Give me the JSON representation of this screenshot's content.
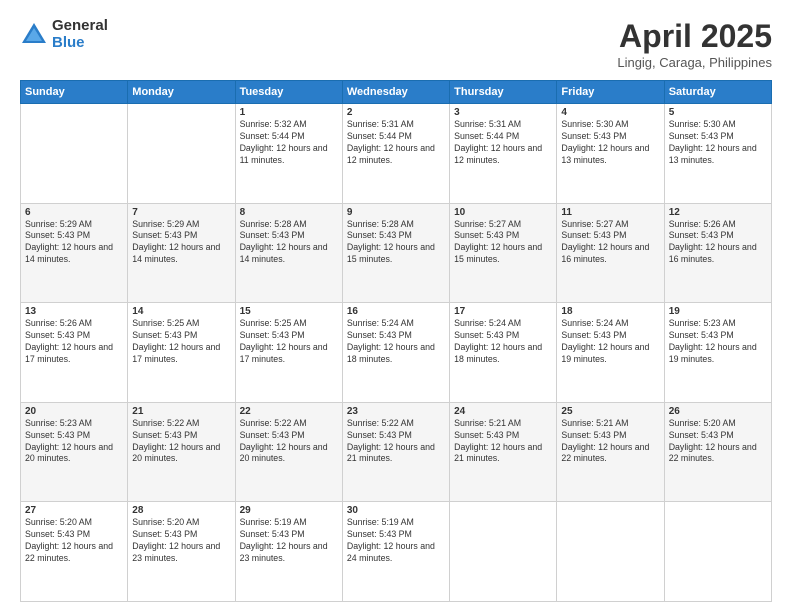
{
  "logo": {
    "general": "General",
    "blue": "Blue"
  },
  "title": "April 2025",
  "subtitle": "Lingig, Caraga, Philippines",
  "days": [
    "Sunday",
    "Monday",
    "Tuesday",
    "Wednesday",
    "Thursday",
    "Friday",
    "Saturday"
  ],
  "weeks": [
    [
      {
        "date": "",
        "info": ""
      },
      {
        "date": "",
        "info": ""
      },
      {
        "date": "1",
        "info": "Sunrise: 5:32 AM\nSunset: 5:44 PM\nDaylight: 12 hours and 11 minutes."
      },
      {
        "date": "2",
        "info": "Sunrise: 5:31 AM\nSunset: 5:44 PM\nDaylight: 12 hours and 12 minutes."
      },
      {
        "date": "3",
        "info": "Sunrise: 5:31 AM\nSunset: 5:44 PM\nDaylight: 12 hours and 12 minutes."
      },
      {
        "date": "4",
        "info": "Sunrise: 5:30 AM\nSunset: 5:43 PM\nDaylight: 12 hours and 13 minutes."
      },
      {
        "date": "5",
        "info": "Sunrise: 5:30 AM\nSunset: 5:43 PM\nDaylight: 12 hours and 13 minutes."
      }
    ],
    [
      {
        "date": "6",
        "info": "Sunrise: 5:29 AM\nSunset: 5:43 PM\nDaylight: 12 hours and 14 minutes."
      },
      {
        "date": "7",
        "info": "Sunrise: 5:29 AM\nSunset: 5:43 PM\nDaylight: 12 hours and 14 minutes."
      },
      {
        "date": "8",
        "info": "Sunrise: 5:28 AM\nSunset: 5:43 PM\nDaylight: 12 hours and 14 minutes."
      },
      {
        "date": "9",
        "info": "Sunrise: 5:28 AM\nSunset: 5:43 PM\nDaylight: 12 hours and 15 minutes."
      },
      {
        "date": "10",
        "info": "Sunrise: 5:27 AM\nSunset: 5:43 PM\nDaylight: 12 hours and 15 minutes."
      },
      {
        "date": "11",
        "info": "Sunrise: 5:27 AM\nSunset: 5:43 PM\nDaylight: 12 hours and 16 minutes."
      },
      {
        "date": "12",
        "info": "Sunrise: 5:26 AM\nSunset: 5:43 PM\nDaylight: 12 hours and 16 minutes."
      }
    ],
    [
      {
        "date": "13",
        "info": "Sunrise: 5:26 AM\nSunset: 5:43 PM\nDaylight: 12 hours and 17 minutes."
      },
      {
        "date": "14",
        "info": "Sunrise: 5:25 AM\nSunset: 5:43 PM\nDaylight: 12 hours and 17 minutes."
      },
      {
        "date": "15",
        "info": "Sunrise: 5:25 AM\nSunset: 5:43 PM\nDaylight: 12 hours and 17 minutes."
      },
      {
        "date": "16",
        "info": "Sunrise: 5:24 AM\nSunset: 5:43 PM\nDaylight: 12 hours and 18 minutes."
      },
      {
        "date": "17",
        "info": "Sunrise: 5:24 AM\nSunset: 5:43 PM\nDaylight: 12 hours and 18 minutes."
      },
      {
        "date": "18",
        "info": "Sunrise: 5:24 AM\nSunset: 5:43 PM\nDaylight: 12 hours and 19 minutes."
      },
      {
        "date": "19",
        "info": "Sunrise: 5:23 AM\nSunset: 5:43 PM\nDaylight: 12 hours and 19 minutes."
      }
    ],
    [
      {
        "date": "20",
        "info": "Sunrise: 5:23 AM\nSunset: 5:43 PM\nDaylight: 12 hours and 20 minutes."
      },
      {
        "date": "21",
        "info": "Sunrise: 5:22 AM\nSunset: 5:43 PM\nDaylight: 12 hours and 20 minutes."
      },
      {
        "date": "22",
        "info": "Sunrise: 5:22 AM\nSunset: 5:43 PM\nDaylight: 12 hours and 20 minutes."
      },
      {
        "date": "23",
        "info": "Sunrise: 5:22 AM\nSunset: 5:43 PM\nDaylight: 12 hours and 21 minutes."
      },
      {
        "date": "24",
        "info": "Sunrise: 5:21 AM\nSunset: 5:43 PM\nDaylight: 12 hours and 21 minutes."
      },
      {
        "date": "25",
        "info": "Sunrise: 5:21 AM\nSunset: 5:43 PM\nDaylight: 12 hours and 22 minutes."
      },
      {
        "date": "26",
        "info": "Sunrise: 5:20 AM\nSunset: 5:43 PM\nDaylight: 12 hours and 22 minutes."
      }
    ],
    [
      {
        "date": "27",
        "info": "Sunrise: 5:20 AM\nSunset: 5:43 PM\nDaylight: 12 hours and 22 minutes."
      },
      {
        "date": "28",
        "info": "Sunrise: 5:20 AM\nSunset: 5:43 PM\nDaylight: 12 hours and 23 minutes."
      },
      {
        "date": "29",
        "info": "Sunrise: 5:19 AM\nSunset: 5:43 PM\nDaylight: 12 hours and 23 minutes."
      },
      {
        "date": "30",
        "info": "Sunrise: 5:19 AM\nSunset: 5:43 PM\nDaylight: 12 hours and 24 minutes."
      },
      {
        "date": "",
        "info": ""
      },
      {
        "date": "",
        "info": ""
      },
      {
        "date": "",
        "info": ""
      }
    ]
  ]
}
